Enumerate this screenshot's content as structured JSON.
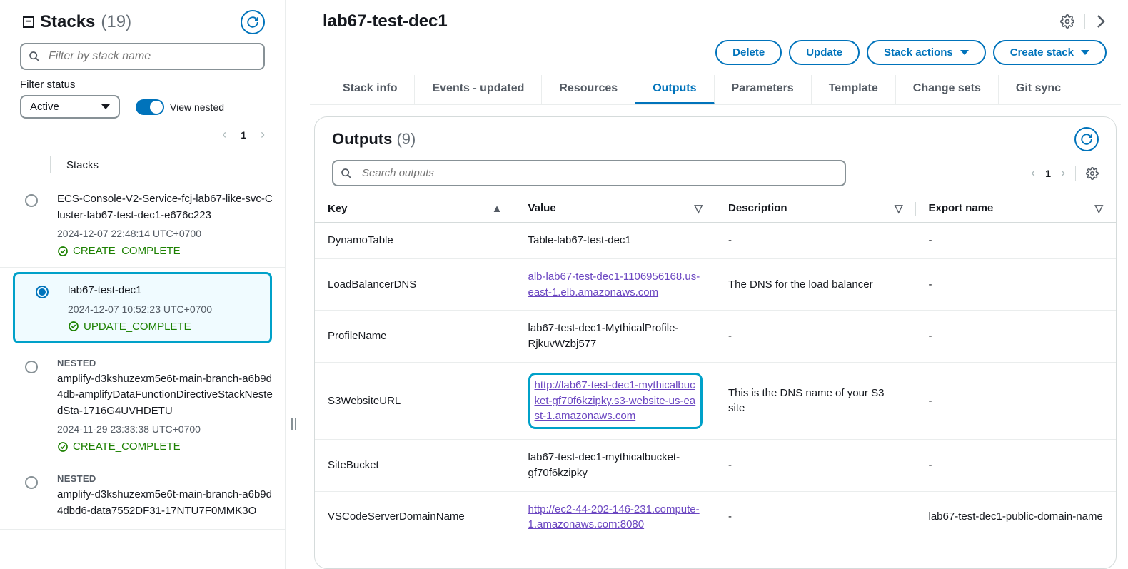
{
  "sidebar": {
    "title": "Stacks",
    "count": "(19)",
    "filter_placeholder": "Filter by stack name",
    "filter_status_label": "Filter status",
    "status_select": "Active",
    "view_nested_label": "View nested",
    "page": "1",
    "list_header": "Stacks",
    "items": [
      {
        "name": "ECS-Console-V2-Service-fcj-lab67-like-svc-Cluster-lab67-test-dec1-e676c223",
        "time": "2024-12-07 22:48:14 UTC+0700",
        "status": "CREATE_COMPLETE",
        "nested": false,
        "selected": false
      },
      {
        "name": "lab67-test-dec1",
        "time": "2024-12-07 10:52:23 UTC+0700",
        "status": "UPDATE_COMPLETE",
        "nested": false,
        "selected": true
      },
      {
        "name": "amplify-d3kshuzexm5e6t-main-branch-a6b9d4db-amplifyDataFunctionDirectiveStackNestedSta-1716G4UVHDETU",
        "time": "2024-11-29 23:33:38 UTC+0700",
        "status": "CREATE_COMPLETE",
        "nested": true,
        "selected": false
      },
      {
        "name": "amplify-d3kshuzexm5e6t-main-branch-a6b9d4dbd6-data7552DF31-17NTU7F0MMK3O",
        "time": "",
        "status": "",
        "nested": true,
        "selected": false
      }
    ]
  },
  "main": {
    "title": "lab67-test-dec1",
    "buttons": {
      "delete": "Delete",
      "update": "Update",
      "stack_actions": "Stack actions",
      "create_stack": "Create stack"
    },
    "tabs": [
      "Stack info",
      "Events - updated",
      "Resources",
      "Outputs",
      "Parameters",
      "Template",
      "Change sets",
      "Git sync"
    ],
    "active_tab": "Outputs"
  },
  "outputs": {
    "title": "Outputs",
    "count": "(9)",
    "search_placeholder": "Search outputs",
    "page": "1",
    "columns": {
      "key": "Key",
      "value": "Value",
      "description": "Description",
      "export": "Export name"
    },
    "rows": [
      {
        "key": "DynamoTable",
        "value": "Table-lab67-test-dec1",
        "link": false,
        "description": "-",
        "export": "-"
      },
      {
        "key": "LoadBalancerDNS",
        "value": "alb-lab67-test-dec1-1106956168.us-east-1.elb.amazonaws.com",
        "link": true,
        "description": "The DNS for the load balancer",
        "export": "-"
      },
      {
        "key": "ProfileName",
        "value": "lab67-test-dec1-MythicalProfile-RjkuvWzbj577",
        "link": false,
        "description": "-",
        "export": "-"
      },
      {
        "key": "S3WebsiteURL",
        "value": "http://lab67-test-dec1-mythicalbucket-gf70f6kzipky.s3-website-us-east-1.amazonaws.com",
        "link": true,
        "highlight": true,
        "description": "This is the DNS name of your S3 site",
        "export": "-"
      },
      {
        "key": "SiteBucket",
        "value": "lab67-test-dec1-mythicalbucket-gf70f6kzipky",
        "link": false,
        "description": "-",
        "export": "-"
      },
      {
        "key": "VSCodeServerDomainName",
        "value": "http://ec2-44-202-146-231.compute-1.amazonaws.com:8080",
        "link": true,
        "description": "-",
        "export": "lab67-test-dec1-public-domain-name"
      }
    ]
  },
  "misc": {
    "nested_label": "NESTED"
  }
}
